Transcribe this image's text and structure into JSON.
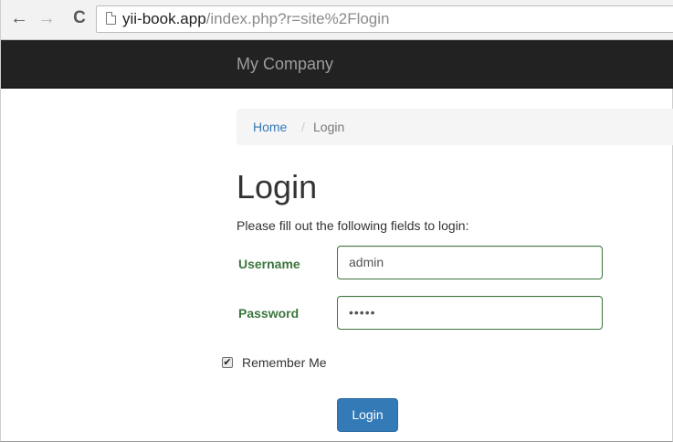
{
  "browser": {
    "back_glyph": "←",
    "forward_glyph": "→",
    "reload_glyph": "C",
    "url_host": "yii-book.app",
    "url_path": "/index.php?r=site%2Flogin"
  },
  "navbar": {
    "brand": "My Company"
  },
  "breadcrumb": {
    "home": "Home",
    "separator": "/",
    "current": "Login"
  },
  "main": {
    "title": "Login",
    "intro": "Please fill out the following fields to login:"
  },
  "form": {
    "username_label": "Username",
    "username_value": "admin",
    "password_label": "Password",
    "password_value": "•••••",
    "remember_label": "Remember Me",
    "remember_checked": true,
    "remember_glyph": "✔",
    "submit_label": "Login"
  },
  "colors": {
    "navbar_bg": "#222222",
    "link": "#337ab7",
    "success_green": "#3c763d",
    "button_primary": "#337ab7"
  },
  "icons": {
    "page_icon": "document-icon"
  }
}
